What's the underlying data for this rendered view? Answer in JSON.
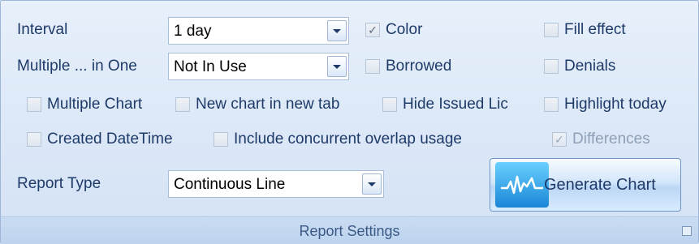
{
  "interval": {
    "label": "Interval",
    "value": "1 day"
  },
  "multiple_in_one": {
    "label": "Multiple ... in One",
    "value": "Not In Use"
  },
  "report_type": {
    "label": "Report Type",
    "value": "Continuous Line"
  },
  "checkboxes": {
    "color": {
      "label": "Color",
      "checked": true
    },
    "fill_effect": {
      "label": "Fill effect",
      "checked": false
    },
    "borrowed": {
      "label": "Borrowed",
      "checked": false
    },
    "denials": {
      "label": "Denials",
      "checked": false
    },
    "multiple_chart": {
      "label": "Multiple Chart",
      "checked": false
    },
    "new_chart_new_tab": {
      "label": "New chart in new tab",
      "checked": false
    },
    "hide_issued_lic": {
      "label": "Hide Issued Lic",
      "checked": false
    },
    "highlight_today": {
      "label": "Highlight today",
      "checked": false
    },
    "created_datetime": {
      "label": "Created DateTime",
      "checked": false
    },
    "include_concurrent": {
      "label": "Include concurrent overlap usage",
      "checked": false
    },
    "differences": {
      "label": "Differences",
      "checked": true,
      "disabled": true
    }
  },
  "generate_button": {
    "label": "Generate Chart"
  },
  "group": {
    "title": "Report Settings"
  },
  "colors": {
    "accent": "#1e3a68",
    "panel": "#dbe7f7",
    "footer": "#c3d7f0"
  }
}
